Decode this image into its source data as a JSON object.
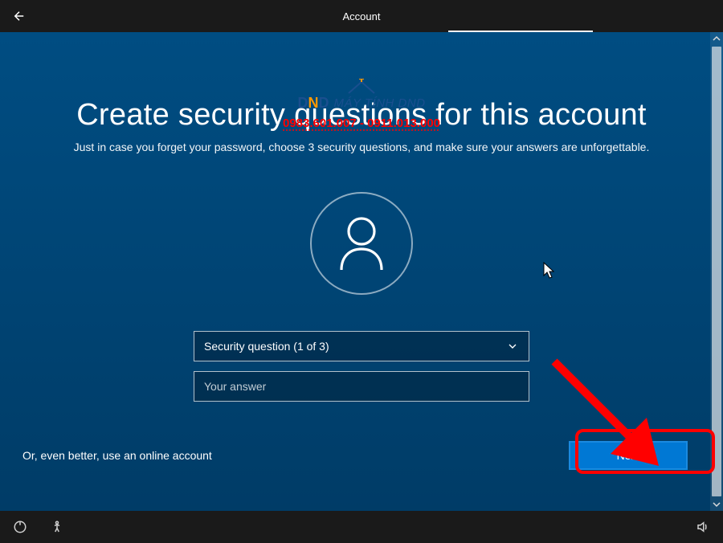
{
  "topbar": {
    "title": "Account"
  },
  "main": {
    "heading": "Create security questions for this account",
    "subheading": "Just in case you forget your password, choose 3 security questions, and make sure your answers are unforgettable."
  },
  "form": {
    "question_select": "Security question (1 of 3)",
    "answer_placeholder": "Your answer"
  },
  "footer": {
    "online_link": "Or, even better, use an online account",
    "next_label": "Next"
  },
  "watermark": {
    "logo_left": "D",
    "logo_mid": "N",
    "logo_right": "D",
    "brand": "MÁY TÍNH DND",
    "phone": "0983.601.007 - 0911.013.000"
  }
}
